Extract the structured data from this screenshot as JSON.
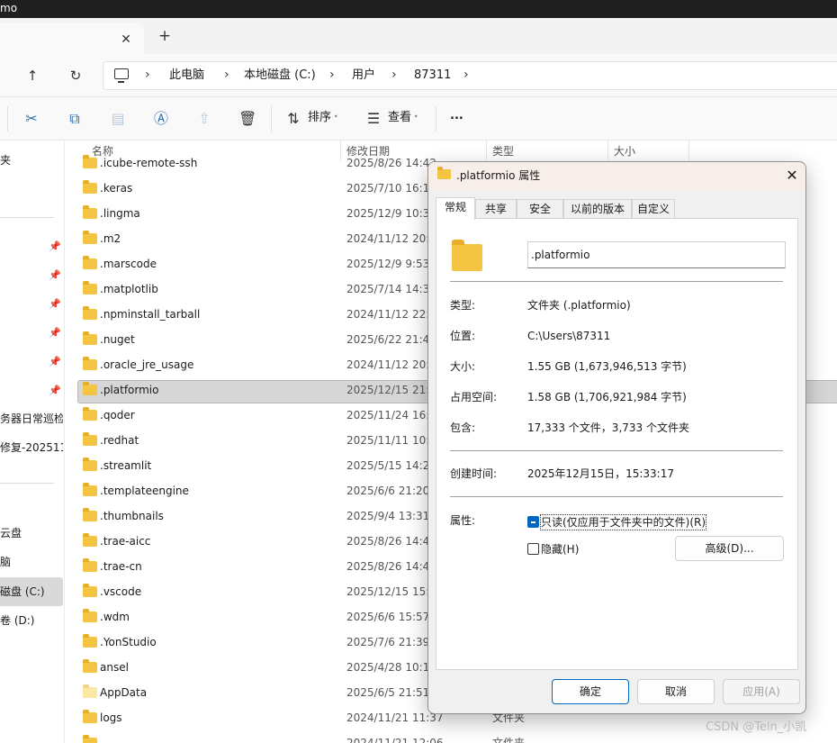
{
  "window": {
    "title_fragment": "mo"
  },
  "tabs": {
    "new_tab": "+",
    "close": "✕"
  },
  "addressbar": {
    "up": "↑",
    "refresh": "↻",
    "crumbs": [
      "此电脑",
      "本地磁盘 (C:)",
      "用户",
      "87311"
    ],
    "chevron": "›"
  },
  "toolbar": {
    "sort_label": "排序",
    "view_label": "查看",
    "more": "..."
  },
  "sidebar": {
    "items": [
      "夹",
      "务器日常巡检",
      "修复-2025110",
      "云盘",
      "脑",
      "磁盘 (C:)",
      "卷 (D:)"
    ]
  },
  "columns": {
    "name": "名称",
    "date": "修改日期",
    "type": "类型",
    "size": "大小"
  },
  "files": [
    {
      "name": ".icube-remote-ssh",
      "date": "2025/8/26 14:42",
      "type": ""
    },
    {
      "name": ".keras",
      "date": "2025/7/10 16:18",
      "type": ""
    },
    {
      "name": ".lingma",
      "date": "2025/12/9 10:33",
      "type": ""
    },
    {
      "name": ".m2",
      "date": "2024/11/12 20:4",
      "type": ""
    },
    {
      "name": ".marscode",
      "date": "2025/12/9 9:53",
      "type": ""
    },
    {
      "name": ".matplotlib",
      "date": "2025/7/14 14:36",
      "type": ""
    },
    {
      "name": ".npminstall_tarball",
      "date": "2024/11/12 22:2",
      "type": ""
    },
    {
      "name": ".nuget",
      "date": "2025/6/22 21:44",
      "type": ""
    },
    {
      "name": ".oracle_jre_usage",
      "date": "2024/11/12 20:1",
      "type": ""
    },
    {
      "name": ".platformio",
      "date": "2025/12/15 21:2",
      "type": ""
    },
    {
      "name": ".qoder",
      "date": "2025/11/24 16:2",
      "type": ""
    },
    {
      "name": ".redhat",
      "date": "2025/11/11 10:2",
      "type": ""
    },
    {
      "name": ".streamlit",
      "date": "2025/5/15 14:29",
      "type": ""
    },
    {
      "name": ".templateengine",
      "date": "2025/6/6 21:20",
      "type": ""
    },
    {
      "name": ".thumbnails",
      "date": "2025/9/4 13:31",
      "type": ""
    },
    {
      "name": ".trae-aicc",
      "date": "2025/8/26 14:42",
      "type": ""
    },
    {
      "name": ".trae-cn",
      "date": "2025/8/26 14:41",
      "type": ""
    },
    {
      "name": ".vscode",
      "date": "2025/12/15 15:3",
      "type": ""
    },
    {
      "name": ".wdm",
      "date": "2025/6/6 15:57",
      "type": ""
    },
    {
      "name": ".YonStudio",
      "date": "2025/7/6 21:39",
      "type": ""
    },
    {
      "name": "ansel",
      "date": "2025/4/28 10:12",
      "type": ""
    },
    {
      "name": "AppData",
      "date": "2025/6/5 21:51",
      "type": ""
    },
    {
      "name": "logs",
      "date": "2024/11/21 11:37",
      "type": "文件夹"
    },
    {
      "name": "",
      "date": "2024/11/21 12:06",
      "type": "文件夹"
    }
  ],
  "dialog": {
    "title": ".platformio 属性",
    "close": "✕",
    "tabs": [
      "常规",
      "共享",
      "安全",
      "以前的版本",
      "自定义"
    ],
    "folder_name": ".platformio",
    "props": {
      "type_label": "类型:",
      "type_value": "文件夹 (.platformio)",
      "location_label": "位置:",
      "location_value": "C:\\Users\\87311",
      "size_label": "大小:",
      "size_value": "1.55 GB (1,673,946,513 字节)",
      "disk_label": "占用空间:",
      "disk_value": "1.58 GB (1,706,921,984 字节)",
      "contains_label": "包含:",
      "contains_value": "17,333 个文件，3,733 个文件夹",
      "created_label": "创建时间:",
      "created_value": "2025年12月15日，15:33:17",
      "attributes_label": "属性:"
    },
    "readonly_label": "只读(仅应用于文件夹中的文件)(R)",
    "hidden_label": "隐藏(H)",
    "advanced_button": "高级(D)...",
    "ok_button": "确定",
    "cancel_button": "取消",
    "apply_button": "应用(A)"
  },
  "watermark": "CSDN @Teln_小凯",
  "colors": {
    "accent": "#0067c0",
    "folder": "#f4c542",
    "selection": "#d6d6d6"
  }
}
